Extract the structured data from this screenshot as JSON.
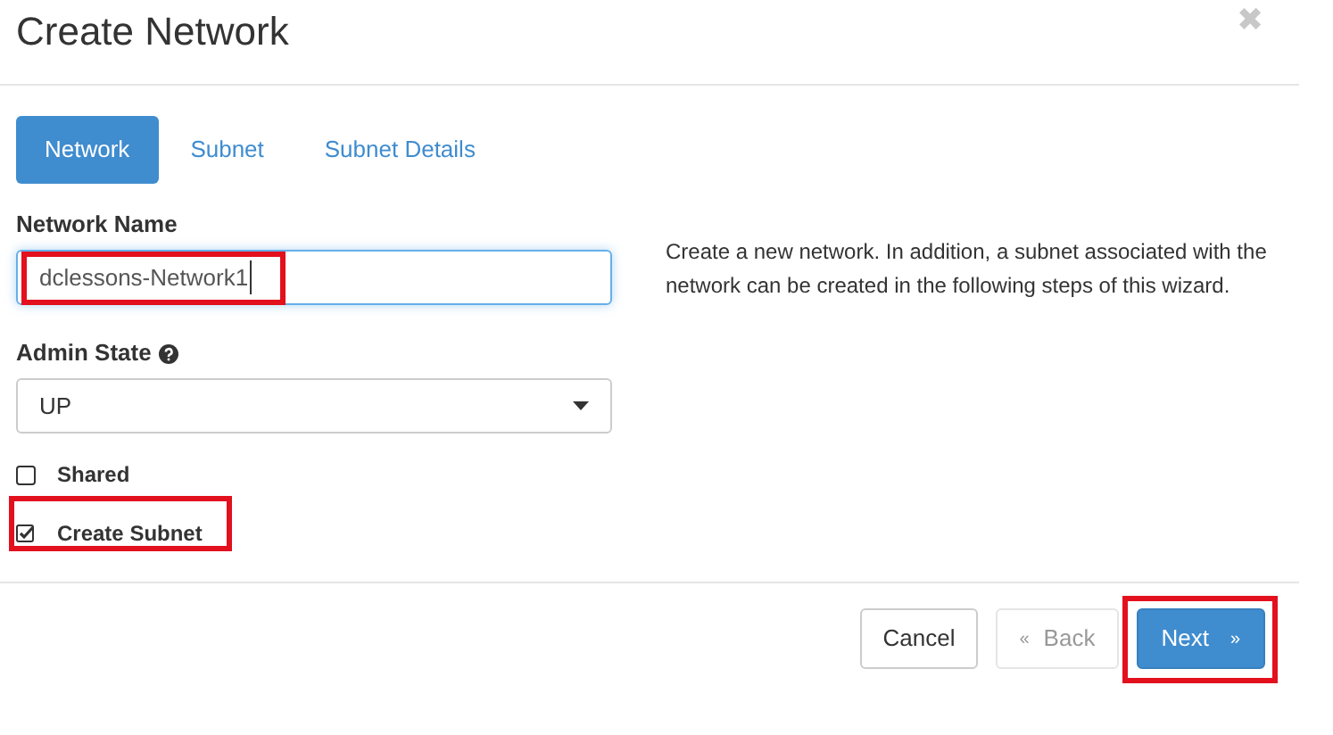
{
  "dialog": {
    "title": "Create Network",
    "close": "✖"
  },
  "tabs": [
    {
      "label": "Network",
      "selected": true
    },
    {
      "label": "Subnet",
      "selected": false
    },
    {
      "label": "Subnet Details",
      "selected": false
    }
  ],
  "form": {
    "network_name": {
      "label": "Network Name",
      "value": "dclessons-Network1",
      "highlighted": true
    },
    "admin_state": {
      "label": "Admin State",
      "value": "UP"
    },
    "checkboxes": [
      {
        "label": "Shared",
        "checked": false,
        "highlighted": false
      },
      {
        "label": "Create Subnet",
        "checked": true,
        "highlighted": true
      }
    ]
  },
  "help_text": "Create a new network. In addition, a subnet associated with the network can be created in the following steps of this wizard.",
  "buttons": [
    {
      "kind": "default",
      "label": "Cancel",
      "disabled": false,
      "highlighted": false
    },
    {
      "kind": "back",
      "prefix": "«",
      "label": "Back",
      "disabled": true,
      "highlighted": false
    },
    {
      "kind": "next",
      "label": "Next",
      "suffix": "»",
      "disabled": false,
      "highlighted": true
    }
  ]
}
